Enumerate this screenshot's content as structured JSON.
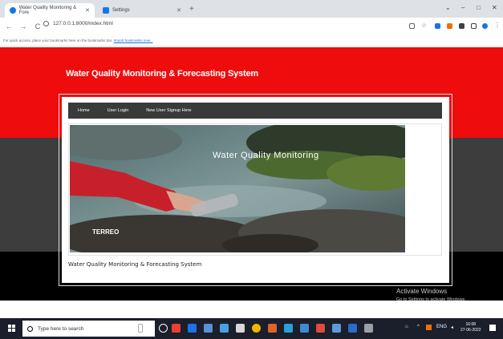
{
  "browser": {
    "tabs": [
      {
        "label": "Water Quality Monitoring & Fore",
        "active": true
      },
      {
        "label": "Settings",
        "active": false
      }
    ],
    "new_tab": "+",
    "url": "127.0.0.1:8000/index.html",
    "bookmarks_bar": {
      "text": "For quick access, place your bookmarks here on the bookmarks bar.",
      "link": "Import bookmarks now..."
    },
    "window_controls": {
      "minimize": "–",
      "maximize": "□",
      "close": "✕",
      "dropdown": "⌄"
    }
  },
  "site": {
    "title": "Water Quality Monitoring & Forecasting System",
    "nav": [
      "Home",
      "User Login",
      "New User Signup Here"
    ],
    "hero_overlay": "Water Quality Monitoring",
    "hero_logo": "TERREO",
    "caption": "Water Quality Monitoring & Forecasting System"
  },
  "activation": {
    "line1": "Activate Windows",
    "line2": "Go to Settings to activate Windows."
  },
  "taskbar": {
    "search_placeholder": "Type here to search",
    "time": "16:08",
    "date": "27-06-2022",
    "lang": "ENG"
  },
  "colors": {
    "header_red": "#ee0c0c",
    "band_dark": "#3d3d3d",
    "menu_bg": "#3a3a3a",
    "taskbar": "#1b1e2b"
  }
}
